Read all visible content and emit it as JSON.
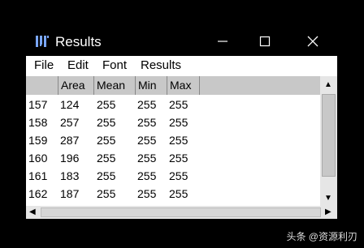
{
  "window": {
    "title": "Results",
    "controls": {
      "minimize": "—",
      "maximize": "☐",
      "close": "✕"
    }
  },
  "menu": [
    "File",
    "Edit",
    "Font",
    "Results"
  ],
  "table": {
    "columns": [
      "",
      "Area",
      "Mean",
      "Min",
      "Max"
    ],
    "rows": [
      [
        "157",
        "124",
        "255",
        "255",
        "255"
      ],
      [
        "158",
        "257",
        "255",
        "255",
        "255"
      ],
      [
        "159",
        "287",
        "255",
        "255",
        "255"
      ],
      [
        "160",
        "196",
        "255",
        "255",
        "255"
      ],
      [
        "161",
        "183",
        "255",
        "255",
        "255"
      ],
      [
        "162",
        "187",
        "255",
        "255",
        "255"
      ]
    ]
  },
  "scroll": {
    "up": "▲",
    "down": "▼",
    "left": "◀",
    "right": "▶"
  },
  "watermark": "头条 @资源利刃"
}
